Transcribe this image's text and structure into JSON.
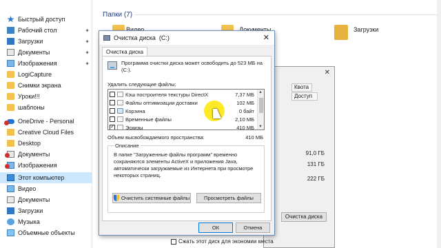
{
  "sidebar": {
    "items": [
      {
        "label": "Быстрый доступ",
        "icon": "star-icon",
        "pinned": false
      },
      {
        "label": "Рабочий стол",
        "icon": "desktop-folder-icon",
        "pinned": true
      },
      {
        "label": "Загрузки",
        "icon": "downloads-icon",
        "pinned": true
      },
      {
        "label": "Документы",
        "icon": "documents-icon",
        "pinned": true
      },
      {
        "label": "Изображения",
        "icon": "pictures-icon",
        "pinned": true
      },
      {
        "label": "LogiCapture",
        "icon": "folder-icon",
        "pinned": false
      },
      {
        "label": "Снимки экрана",
        "icon": "folder-icon",
        "pinned": false
      },
      {
        "label": "Уроки!!!",
        "icon": "folder-icon",
        "pinned": false
      },
      {
        "label": "шаблоны",
        "icon": "folder-icon",
        "pinned": false
      },
      {
        "label": "OneDrive - Personal",
        "icon": "onedrive-icon",
        "pinned": false
      },
      {
        "label": "Creative Cloud Files",
        "icon": "folder-icon",
        "pinned": false
      },
      {
        "label": "Desktop",
        "icon": "folder-icon",
        "pinned": false
      },
      {
        "label": "Документы",
        "icon": "documents-icon",
        "pinned": false
      },
      {
        "label": "Изображения",
        "icon": "pictures-icon",
        "pinned": false
      },
      {
        "label": "Этот компьютер",
        "icon": "this-pc-icon",
        "pinned": false
      },
      {
        "label": "Видео",
        "icon": "video-icon",
        "pinned": false
      },
      {
        "label": "Документы",
        "icon": "documents-icon",
        "pinned": false
      },
      {
        "label": "Загрузки",
        "icon": "downloads-icon",
        "pinned": false
      },
      {
        "label": "Музыка",
        "icon": "music-icon",
        "pinned": false
      },
      {
        "label": "Объемные объекты",
        "icon": "3d-objects-icon",
        "pinned": false
      }
    ]
  },
  "explorer": {
    "section_title": "Папки (7)",
    "folders": [
      "Видео",
      "Документы",
      "Загрузки"
    ]
  },
  "properties_window": {
    "tab_quota": "Квота",
    "tab_access": "Доступ",
    "used": "91,0 ГБ",
    "free": "131 ГБ",
    "capacity": "222 ГБ",
    "cleanup_button": "Очистка диска",
    "compress_label": "Сжать этот диск для экономии места"
  },
  "dialog": {
    "title": "Очистка диска  (C:)",
    "tab": "Очистка диска",
    "intro": "Программа очистки диска может освободить до 523 МБ на (C:).",
    "files_label": "Удалить следующие файлы:",
    "files": [
      {
        "name": "Кэш построителя текстуры DirectX",
        "size": "7,37 МБ",
        "checked": false,
        "icon": "file-icon"
      },
      {
        "name": "Файлы оптимизации доставки",
        "size": "102 МБ",
        "checked": false,
        "icon": "file-icon"
      },
      {
        "name": "Корзина",
        "size": "0 байт",
        "checked": false,
        "icon": "recycle-bin-icon"
      },
      {
        "name": "Временные файлы",
        "size": "2,10 МБ",
        "checked": false,
        "icon": "file-icon"
      },
      {
        "name": "Эскизы",
        "size": "410 МБ",
        "checked": true,
        "icon": "file-icon"
      }
    ],
    "space_label": "Объем высвобождаемого пространства:",
    "space_value": "410 МБ",
    "description_title": "Описание",
    "description": "В папке \"Загруженные файлы программ\" временно сохраняются элементы ActiveX и приложения Java, автоматически загружаемые из Интернета при просмотре некоторых страниц.",
    "clean_system_button": "Очистить системные файлы",
    "view_files_button": "Просмотреть файлы",
    "ok_button": "ОК",
    "cancel_button": "Отмена"
  },
  "colors": {
    "selection": "#cce8ff",
    "cursor_highlight": "#ffe600",
    "accent": "#0078d7"
  }
}
